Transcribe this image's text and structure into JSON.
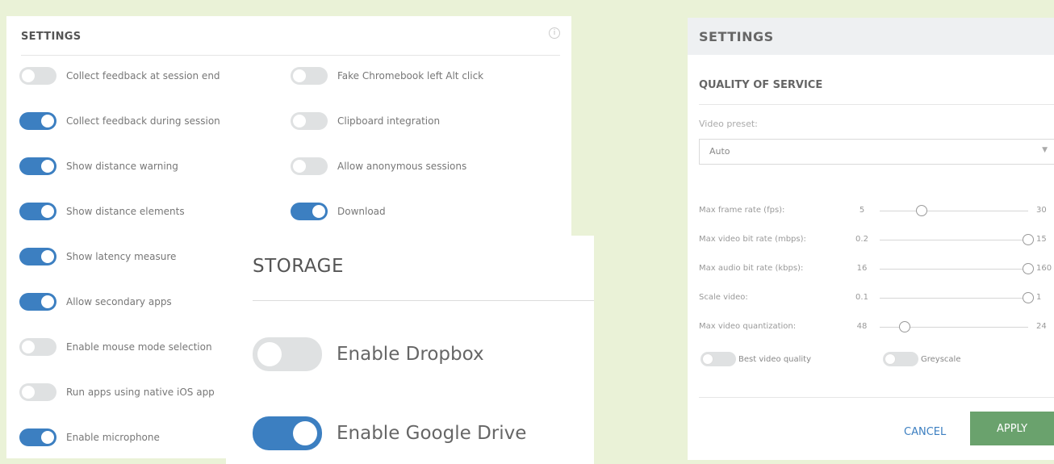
{
  "settings_left": {
    "title": "SETTINGS",
    "info_icon": "i",
    "col1": [
      {
        "label": "Collect feedback at session end",
        "on": false
      },
      {
        "label": "Collect feedback during session",
        "on": true
      },
      {
        "label": "Show distance warning",
        "on": true
      },
      {
        "label": "Show distance elements",
        "on": true
      },
      {
        "label": "Show latency measure",
        "on": true
      },
      {
        "label": "Allow secondary apps",
        "on": true
      },
      {
        "label": "Enable mouse mode selection",
        "on": false
      },
      {
        "label": "Run apps using native iOS app",
        "on": false
      },
      {
        "label": "Enable microphone",
        "on": true
      }
    ],
    "col2": [
      {
        "label": "Fake Chromebook left Alt click",
        "on": false
      },
      {
        "label": "Clipboard integration",
        "on": false
      },
      {
        "label": "Allow anonymous sessions",
        "on": false
      },
      {
        "label": "Download",
        "on": true
      }
    ]
  },
  "storage": {
    "title": "STORAGE",
    "items": [
      {
        "label": "Enable Dropbox",
        "on": false
      },
      {
        "label": "Enable Google Drive",
        "on": true
      }
    ]
  },
  "settings_right": {
    "title": "SETTINGS",
    "section": "QUALITY OF SERVICE",
    "preset_label": "Video preset:",
    "preset_value": "Auto",
    "sliders": [
      {
        "name": "Max frame rate (fps):",
        "min": "5",
        "max": "30",
        "min_value": 5,
        "max_value": 30,
        "value": 12
      },
      {
        "name": "Max video bit rate (mbps):",
        "min": "0.2",
        "max": "15",
        "min_value": 0.2,
        "max_value": 15,
        "value": 15
      },
      {
        "name": "Max audio bit rate (kbps):",
        "min": "16",
        "max": "160",
        "min_value": 16,
        "max_value": 160,
        "value": 160
      },
      {
        "name": "Scale video:",
        "min": "0.1",
        "max": "1",
        "min_value": 0.1,
        "max_value": 1,
        "value": 1
      },
      {
        "name": "Max video quantization:",
        "min": "48",
        "max": "24",
        "min_value": 48,
        "max_value": 24,
        "value": 44
      }
    ],
    "toggles": [
      {
        "label": "Best video quality",
        "on": false
      },
      {
        "label": "Greyscale",
        "on": false
      }
    ],
    "cancel_label": "CANCEL",
    "apply_label": "APPLY"
  },
  "colors": {
    "background": "#eaf2d7",
    "toggle_on": "#3c7fc1",
    "toggle_off": "#dfe1e2",
    "apply_button": "#6aa26d",
    "cancel_link": "#3c7fc1"
  }
}
